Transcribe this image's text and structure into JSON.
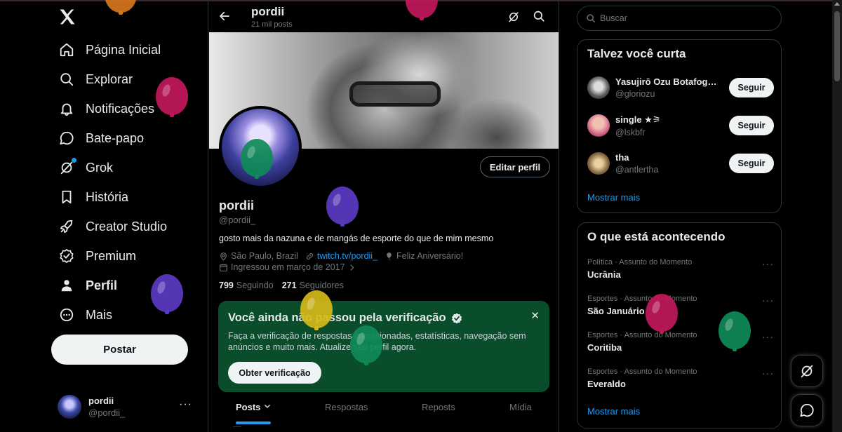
{
  "colors": {
    "background": "#000000",
    "accent": "#1d9bf0",
    "verification_card": "#0a4d2b",
    "text_primary": "#e7e9ea",
    "text_secondary": "#71767b",
    "balloon_orange": "#d6761c",
    "balloon_magenta": "#c2185b",
    "balloon_purple": "#5b3bc4",
    "balloon_green": "#0f8a57",
    "balloon_yellow": "#d6b91a"
  },
  "sidebar": {
    "logo_icon": "x-logo-icon",
    "items": [
      {
        "label": "Página Inicial",
        "icon": "home-icon"
      },
      {
        "label": "Explorar",
        "icon": "search-icon"
      },
      {
        "label": "Notificações",
        "icon": "bell-icon"
      },
      {
        "label": "Bate-papo",
        "icon": "chat-icon"
      },
      {
        "label": "Grok",
        "icon": "grok-icon"
      },
      {
        "label": "História",
        "icon": "bookmark-icon"
      },
      {
        "label": "Creator Studio",
        "icon": "rocket-icon"
      },
      {
        "label": "Premium",
        "icon": "verified-icon"
      },
      {
        "label": "Perfil",
        "icon": "person-icon"
      },
      {
        "label": "Mais",
        "icon": "more-circle-icon"
      }
    ],
    "post_button": "Postar",
    "account": {
      "name": "pordii",
      "handle": "@pordii_",
      "more": "···"
    }
  },
  "header": {
    "name": "pordii",
    "post_count": "21 mil posts"
  },
  "profile": {
    "edit_button": "Editar perfil",
    "name": "pordii",
    "handle": "@pordii_",
    "bio": "gosto mais da nazuna e de mangás de esporte do que de mim mesmo",
    "location": "São Paulo, Brazil",
    "link": "twitch.tv/pordii_",
    "birthday": "Feliz Aniversário!",
    "joined": "Ingressou em março de 2017",
    "following_count": "799",
    "following_label": "Seguindo",
    "followers_count": "271",
    "followers_label": "Seguidores"
  },
  "verification": {
    "title": "Você ainda não passou pela verificação",
    "description": "Faça a verificação de respostas impulsionadas, estatísticas, navegação sem anúncios e muito mais. Atualize seu perfil agora.",
    "button": "Obter verificação",
    "close": "✕"
  },
  "tabs": [
    {
      "label": "Posts"
    },
    {
      "label": "Respostas"
    },
    {
      "label": "Reposts"
    },
    {
      "label": "Mídia"
    }
  ],
  "search": {
    "placeholder": "Buscar"
  },
  "who_to_follow": {
    "title": "Talvez você curta",
    "items": [
      {
        "name": "Yasujirō Ozu Botafogu...",
        "handle": "@gloriozu",
        "button": "Seguir"
      },
      {
        "name": "single ★⚞",
        "handle": "@lskbfr",
        "button": "Seguir"
      },
      {
        "name": "tha",
        "handle": "@antlertha",
        "button": "Seguir"
      }
    ],
    "more": "Mostrar mais"
  },
  "trends": {
    "title": "O que está acontecendo",
    "items": [
      {
        "context": "Política · Assunto do Momento",
        "name": "Ucrânia"
      },
      {
        "context": "Esportes · Assunto do Momento",
        "name": "São Januário"
      },
      {
        "context": "Esportes · Assunto do Momento",
        "name": "Coritiba"
      },
      {
        "context": "Esportes · Assunto do Momento",
        "name": "Everaldo"
      }
    ],
    "more": "Mostrar mais",
    "dots": "···"
  }
}
